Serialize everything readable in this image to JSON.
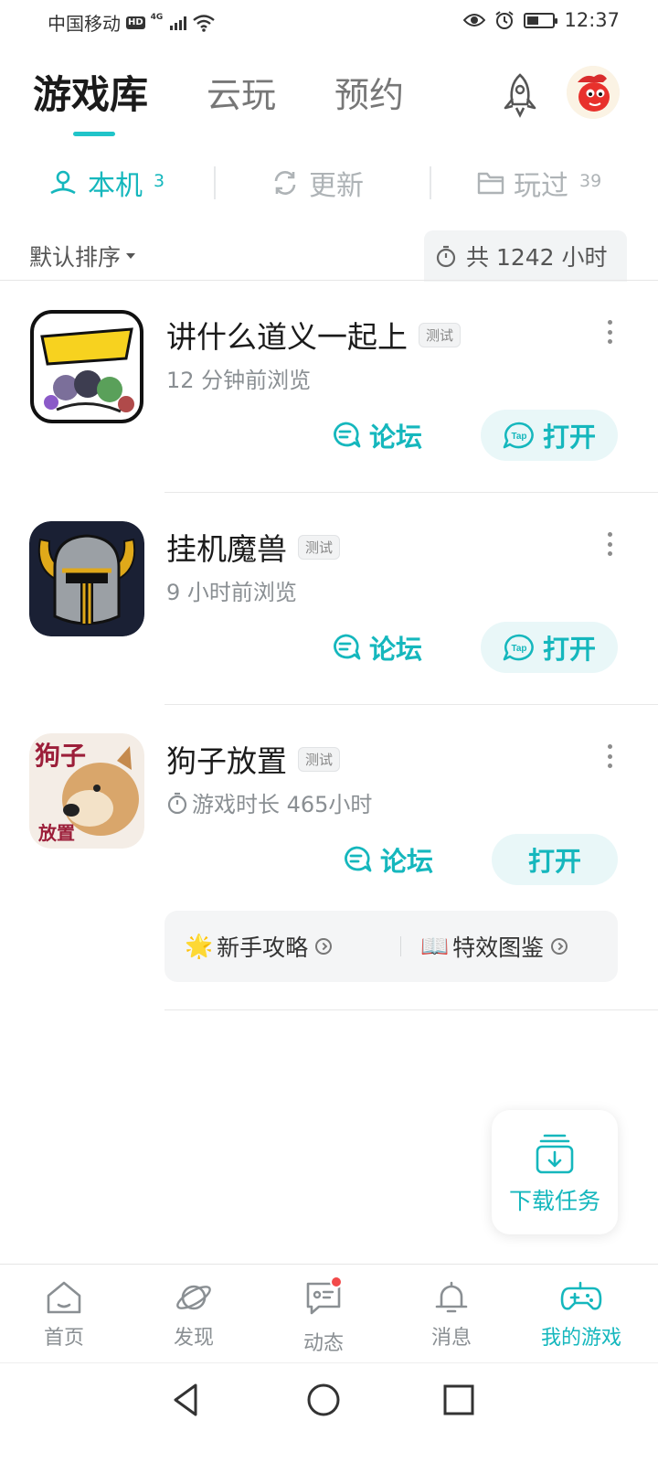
{
  "status_bar": {
    "carrier": "中国移动",
    "hd": "HD",
    "network": "4G",
    "time": "12:37",
    "battery_level": 0.45
  },
  "header": {
    "tabs": [
      {
        "label": "游戏库",
        "active": true
      },
      {
        "label": "云玩",
        "active": false
      },
      {
        "label": "预约",
        "active": false
      }
    ],
    "icons": [
      "rocket-icon",
      "avatar"
    ]
  },
  "sub_tabs": [
    {
      "label": "本机",
      "count": "3",
      "icon": "local-icon",
      "active": true
    },
    {
      "label": "更新",
      "count": "",
      "icon": "refresh-icon",
      "active": false
    },
    {
      "label": "玩过",
      "count": "39",
      "icon": "folder-icon",
      "active": false
    }
  ],
  "sort": {
    "label": "默认排序",
    "total_hours": "共 1242 小时"
  },
  "games": [
    {
      "title": "讲什么道义一起上",
      "tag": "测试",
      "subtitle": "12 分钟前浏览",
      "forum_label": "论坛",
      "open_label": "打开",
      "open_icon": "Tap"
    },
    {
      "title": "挂机魔兽",
      "tag": "测试",
      "subtitle": "9 小时前浏览",
      "forum_label": "论坛",
      "open_label": "打开",
      "open_icon": "Tap"
    },
    {
      "title": "狗子放置",
      "tag": "测试",
      "subtitle": "游戏时长 465小时",
      "forum_label": "论坛",
      "open_label": "打开",
      "icon_text_top": "狗子",
      "icon_text_bottom": "放置",
      "links": [
        {
          "emoji": "🌟",
          "label": "新手攻略"
        },
        {
          "emoji": "📖",
          "label": "特效图鉴"
        }
      ]
    }
  ],
  "download_fab": {
    "label": "下载任务"
  },
  "bottom_nav": [
    {
      "label": "首页",
      "icon": "home-icon",
      "active": false
    },
    {
      "label": "发现",
      "icon": "planet-icon",
      "active": false
    },
    {
      "label": "动态",
      "icon": "chat-icon",
      "active": false,
      "badge": true
    },
    {
      "label": "消息",
      "icon": "bell-icon",
      "active": false
    },
    {
      "label": "我的游戏",
      "icon": "gamepad-icon",
      "active": true
    }
  ],
  "colors": {
    "accent": "#15b7bd",
    "accent_light": "#e9f7f8",
    "badge": "#f24a4a"
  }
}
